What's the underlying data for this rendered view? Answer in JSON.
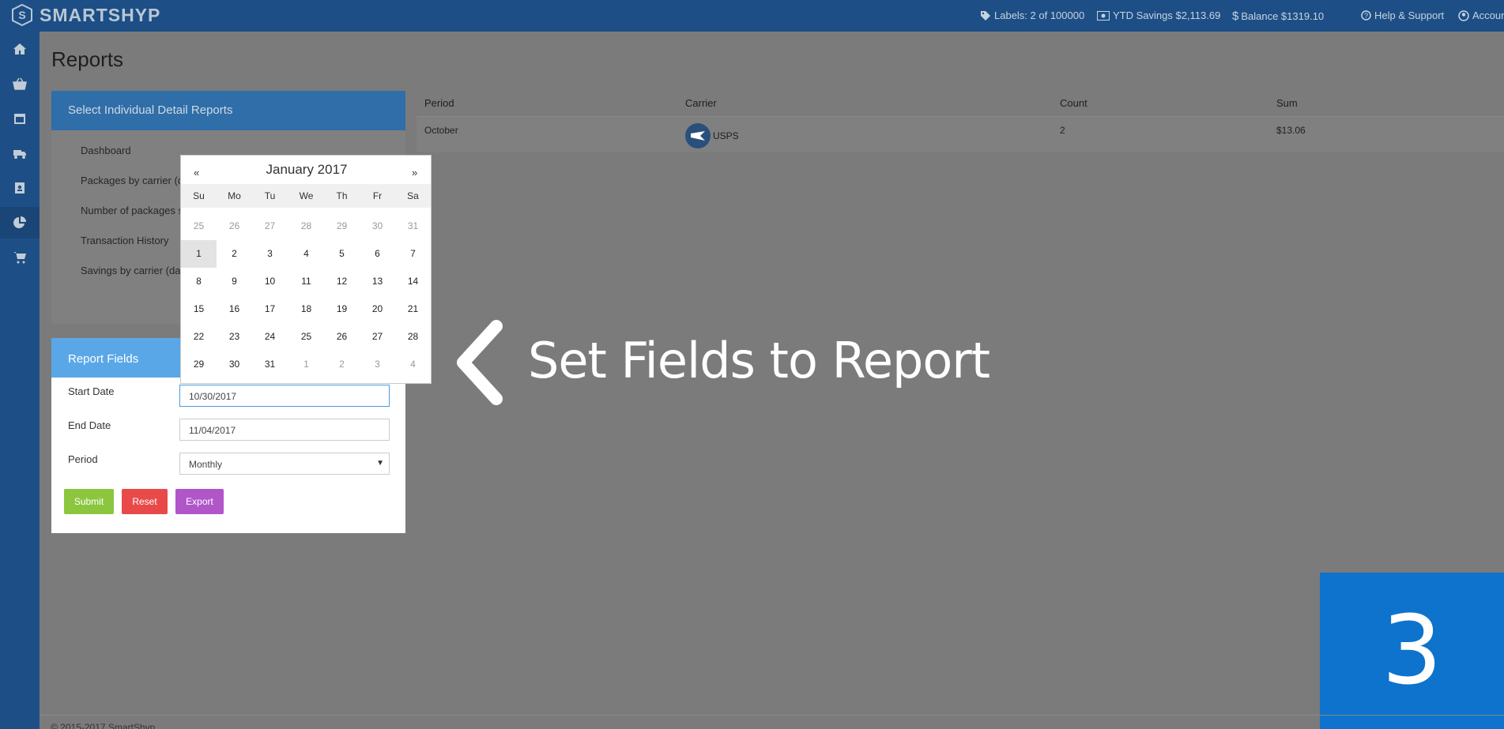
{
  "brand": {
    "name": "SMARTSHYP"
  },
  "topbar": {
    "labels": "Labels: 2 of 100000",
    "ytd_savings": "YTD Savings $2,113.69",
    "balance": "Balance $1319.10",
    "help": "Help & Support",
    "account": "Account"
  },
  "sidebar": {
    "icons": [
      "home-icon",
      "shopping-basket-icon",
      "calendar-icon",
      "truck-icon",
      "address-book-icon",
      "pie-chart-icon",
      "cart-icon"
    ],
    "active_index": 5
  },
  "page": {
    "title": "Reports"
  },
  "detail_reports": {
    "heading": "Select Individual Detail Reports",
    "items": [
      "Dashboard",
      "Packages by carrier (da",
      "Number of packages sh",
      "Transaction History",
      "Savings by carrier (daily"
    ]
  },
  "report_fields": {
    "heading": "Report Fields",
    "start_date_label": "Start Date",
    "start_date_value": "10/30/2017",
    "end_date_label": "End Date",
    "end_date_value": "11/04/2017",
    "period_label": "Period",
    "period_value": "Monthly",
    "submit_label": "Submit",
    "reset_label": "Reset",
    "export_label": "Export"
  },
  "results": {
    "columns": [
      "Period",
      "Carrier",
      "Count",
      "Sum"
    ],
    "rows": [
      {
        "period": "October",
        "carrier": "USPS",
        "count": "2",
        "sum": "$13.06"
      }
    ]
  },
  "datepicker": {
    "prev": "«",
    "next": "»",
    "title": "January 2017",
    "weekdays": [
      "Su",
      "Mo",
      "Tu",
      "We",
      "Th",
      "Fr",
      "Sa"
    ],
    "weeks": [
      [
        "25",
        "26",
        "27",
        "28",
        "29",
        "30",
        "31"
      ],
      [
        "1",
        "2",
        "3",
        "4",
        "5",
        "6",
        "7"
      ],
      [
        "8",
        "9",
        "10",
        "11",
        "12",
        "13",
        "14"
      ],
      [
        "15",
        "16",
        "17",
        "18",
        "19",
        "20",
        "21"
      ],
      [
        "22",
        "23",
        "24",
        "25",
        "26",
        "27",
        "28"
      ],
      [
        "29",
        "30",
        "31",
        "1",
        "2",
        "3",
        "4"
      ]
    ],
    "selected_day": "1"
  },
  "overlay": {
    "text": "Set Fields to Report",
    "step": "3"
  },
  "footer": {
    "text": "© 2015-2017 SmartShyp"
  },
  "colors": {
    "topbar": "#1d4f86",
    "accent_blue": "#5aa7e8",
    "submit": "#8cc63f",
    "reset": "#e84a4a",
    "export": "#b056c9",
    "step_box": "#0d73cc"
  }
}
